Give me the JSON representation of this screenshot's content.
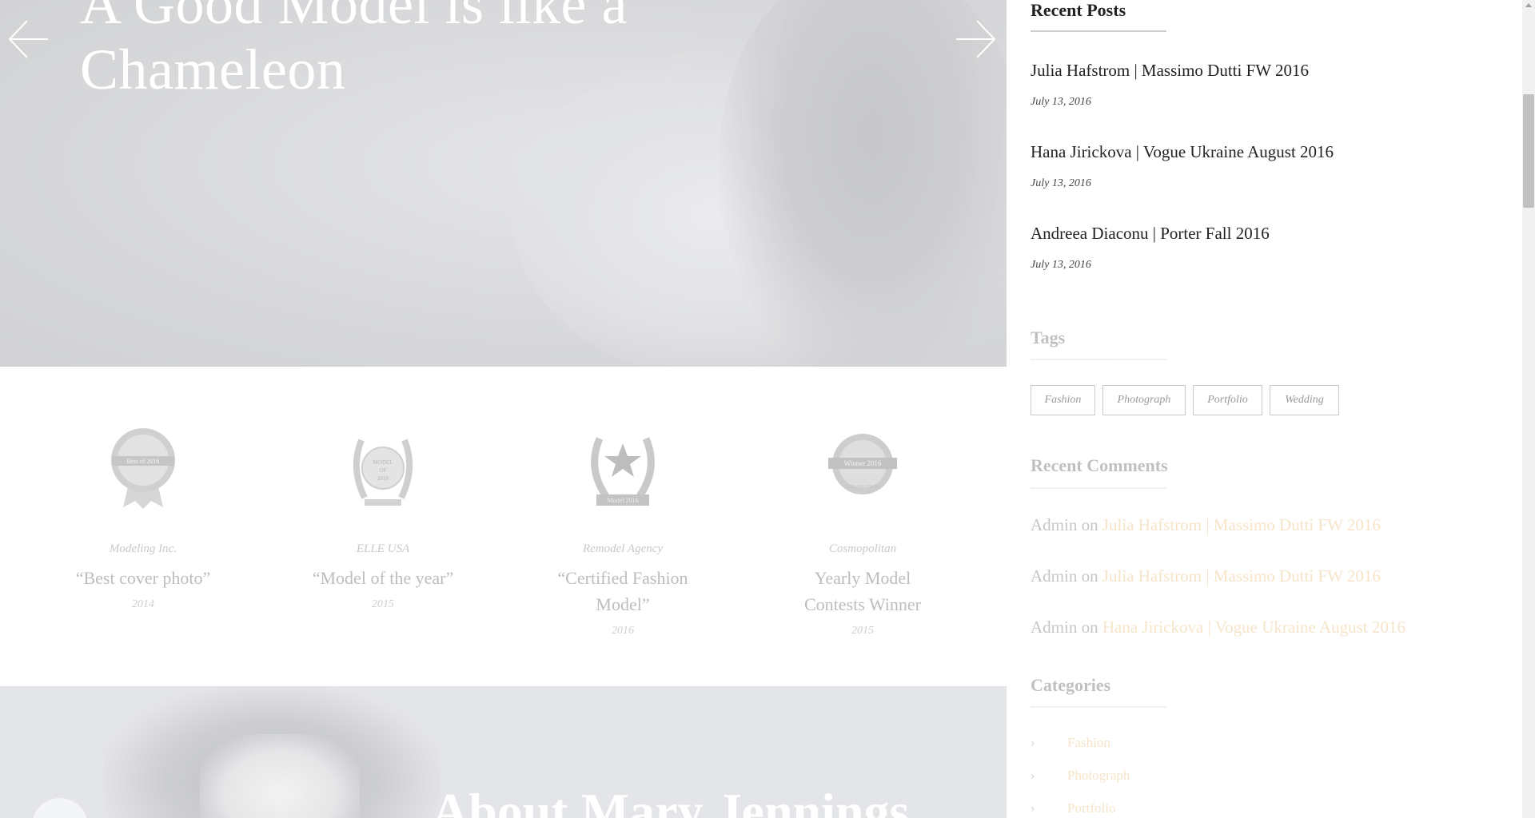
{
  "hero": {
    "title_line1": "A Good Model is like a",
    "title_line2": "Chameleon",
    "prev_icon": "arrow-left-icon",
    "next_icon": "arrow-right-icon"
  },
  "awards": [
    {
      "org": "Modeling Inc.",
      "title": "“Best cover photo”",
      "year": "2014",
      "badge_icon": "ribbon-badge-icon",
      "badge_text": "Best of 2016"
    },
    {
      "org": "ELLE USA",
      "title": "“Model of the year”",
      "year": "2015",
      "badge_icon": "laurel-badge-icon",
      "badge_text": "MODEL OF 2018"
    },
    {
      "org": "Remodel Agency",
      "title_line1": "“Certified Fashion",
      "title_line2": "Model”",
      "year": "2016",
      "badge_icon": "star-laurel-badge-icon",
      "badge_text": "Model 2016"
    },
    {
      "org": "Cosmopolitan",
      "title_line1": "Yearly Model",
      "title_line2": "Contests Winner",
      "year": "2015",
      "badge_icon": "winner-seal-icon",
      "badge_text": "Winner 2016"
    }
  ],
  "about": {
    "title": "About Mary Jennings"
  },
  "sidebar": {
    "recent_posts": {
      "title": "Recent Posts",
      "items": [
        {
          "title": "Julia Hafstrom | Massimo Dutti FW 2016",
          "date": "July 13, 2016"
        },
        {
          "title": "Hana Jirickova | Vogue Ukraine August 2016",
          "date": "July 13, 2016"
        },
        {
          "title": "Andreea Diaconu | Porter Fall 2016",
          "date": "July 13, 2016"
        }
      ]
    },
    "tags": {
      "title": "Tags",
      "items": [
        "Fashion",
        "Photograph",
        "Portfolio",
        "Wedding"
      ]
    },
    "recent_comments": {
      "title": "Recent Comments",
      "on_word": "on",
      "items": [
        {
          "author": "Admin",
          "post": "Julia Hafstrom | Massimo Dutti FW 2016"
        },
        {
          "author": "Admin",
          "post": "Julia Hafstrom | Massimo Dutti FW 2016"
        },
        {
          "author": "Admin",
          "post": "Hana Jirickova | Vogue Ukraine August 2016"
        }
      ]
    },
    "categories": {
      "title": "Categories",
      "items": [
        "Fashion",
        "Photograph",
        "Portfolio"
      ]
    }
  },
  "colors": {
    "link_accent": "#e0a040",
    "text_dark": "#222222",
    "hero_overlay": "#c4c5c8",
    "about_band": "#e4e5e8"
  }
}
